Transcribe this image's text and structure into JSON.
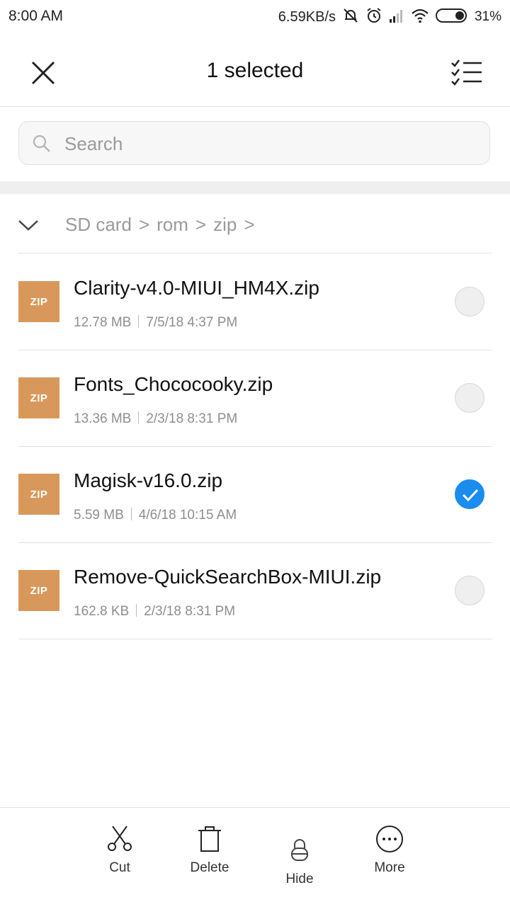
{
  "status_bar": {
    "time": "8:00 AM",
    "net_speed": "6.59KB/s",
    "battery_percent": "31%",
    "icons": [
      "mute-icon",
      "alarm-icon",
      "signal-icon",
      "wifi-icon",
      "battery-icon"
    ]
  },
  "header": {
    "title": "1 selected",
    "close_icon": "close-icon",
    "select_all_icon": "checklist-icon"
  },
  "search": {
    "placeholder": "Search",
    "value": ""
  },
  "breadcrumb": {
    "items": [
      "SD card",
      "rom",
      "zip"
    ],
    "separator": ">"
  },
  "files": [
    {
      "name": "Clarity-v4.0-MIUI_HM4X.zip",
      "size": "12.78 MB",
      "date": "7/5/18 4:37 PM",
      "type_label": "ZIP",
      "selected": false
    },
    {
      "name": "Fonts_Chococooky.zip",
      "size": "13.36 MB",
      "date": "2/3/18 8:31 PM",
      "type_label": "ZIP",
      "selected": false
    },
    {
      "name": "Magisk-v16.0.zip",
      "size": "5.59 MB",
      "date": "4/6/18 10:15 AM",
      "type_label": "ZIP",
      "selected": true
    },
    {
      "name": "Remove-QuickSearchBox-MIUI.zip",
      "size": "162.8 KB",
      "date": "2/3/18 8:31 PM",
      "type_label": "ZIP",
      "selected": false
    }
  ],
  "actions": {
    "cut": "Cut",
    "delete": "Delete",
    "hide": "Hide",
    "more": "More"
  },
  "colors": {
    "accent": "#1a8cf0",
    "zip_badge": "#d9985b",
    "secondary_text": "#8e8e8e"
  }
}
